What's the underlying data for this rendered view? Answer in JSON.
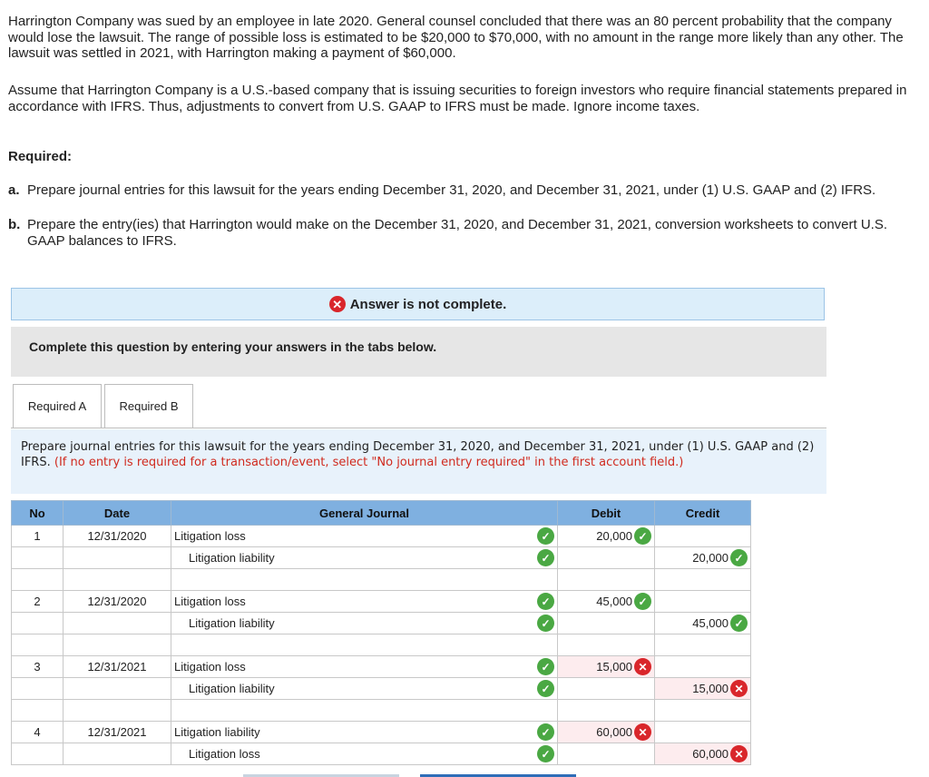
{
  "problem": {
    "p1": "Harrington Company was sued by an employee in late 2020. General counsel concluded that there was an 80 percent probability that the company would lose the lawsuit. The range of possible loss is estimated to be $20,000 to $70,000, with no amount in the range more likely than any other. The lawsuit was settled in 2021, with Harrington making a payment of $60,000.",
    "p2": "Assume that Harrington Company is a U.S.-based company that is issuing securities to foreign investors who require financial statements prepared in accordance with IFRS. Thus, adjustments to convert from U.S. GAAP to IFRS must be made. Ignore income taxes.",
    "required_heading": "Required:",
    "items": [
      {
        "label": "a.",
        "text": "Prepare journal entries for this lawsuit for the years ending December 31, 2020, and December 31, 2021, under (1) U.S. GAAP and (2) IFRS."
      },
      {
        "label": "b.",
        "text": "Prepare the entry(ies) that Harrington would make on the December 31, 2020, and December 31, 2021, conversion worksheets to convert U.S. GAAP balances to IFRS."
      }
    ]
  },
  "banner": {
    "text": "Answer is not complete.",
    "icon": "x-circle-icon"
  },
  "instruction_box": {
    "text": "Complete this question by entering your answers in the tabs below."
  },
  "tabs": [
    {
      "label": "Required A",
      "active": true
    },
    {
      "label": "Required B",
      "active": false
    }
  ],
  "tab_instruction": {
    "main": "Prepare journal entries for this lawsuit for the years ending December 31, 2020, and December 31, 2021, under (1) U.S. GAAP and (2) IFRS.",
    "note": "(If no entry is required for a transaction/event, select \"No journal entry required\" in the first account field.)"
  },
  "journal": {
    "headers": {
      "no": "No",
      "date": "Date",
      "account": "General Journal",
      "debit": "Debit",
      "credit": "Credit"
    },
    "rows": [
      {
        "no": "1",
        "date": "12/31/2020",
        "account": "Litigation loss",
        "indent": false,
        "acct_ok": true,
        "debit": "20,000",
        "debit_ok": true,
        "credit": "",
        "credit_ok": null
      },
      {
        "no": "",
        "date": "",
        "account": "Litigation liability",
        "indent": true,
        "acct_ok": true,
        "debit": "",
        "debit_ok": null,
        "credit": "20,000",
        "credit_ok": true
      },
      {
        "no": "",
        "date": "",
        "account": "",
        "indent": false,
        "acct_ok": null,
        "debit": "",
        "debit_ok": null,
        "credit": "",
        "credit_ok": null
      },
      {
        "no": "2",
        "date": "12/31/2020",
        "account": "Litigation loss",
        "indent": false,
        "acct_ok": true,
        "debit": "45,000",
        "debit_ok": true,
        "credit": "",
        "credit_ok": null
      },
      {
        "no": "",
        "date": "",
        "account": "Litigation liability",
        "indent": true,
        "acct_ok": true,
        "debit": "",
        "debit_ok": null,
        "credit": "45,000",
        "credit_ok": true
      },
      {
        "no": "",
        "date": "",
        "account": "",
        "indent": false,
        "acct_ok": null,
        "debit": "",
        "debit_ok": null,
        "credit": "",
        "credit_ok": null
      },
      {
        "no": "3",
        "date": "12/31/2021",
        "account": "Litigation loss",
        "indent": false,
        "acct_ok": true,
        "debit": "15,000",
        "debit_ok": false,
        "credit": "",
        "credit_ok": null
      },
      {
        "no": "",
        "date": "",
        "account": "Litigation liability",
        "indent": true,
        "acct_ok": true,
        "debit": "",
        "debit_ok": null,
        "credit": "15,000",
        "credit_ok": false
      },
      {
        "no": "",
        "date": "",
        "account": "",
        "indent": false,
        "acct_ok": null,
        "debit": "",
        "debit_ok": null,
        "credit": "",
        "credit_ok": null
      },
      {
        "no": "4",
        "date": "12/31/2021",
        "account": "Litigation liability",
        "indent": false,
        "acct_ok": true,
        "debit": "60,000",
        "debit_ok": false,
        "credit": "",
        "credit_ok": null
      },
      {
        "no": "",
        "date": "",
        "account": "Litigation loss",
        "indent": true,
        "acct_ok": true,
        "debit": "",
        "debit_ok": null,
        "credit": "60,000",
        "credit_ok": false
      }
    ]
  },
  "colors": {
    "correct": "#4aa843",
    "incorrect": "#d9262b",
    "header": "#7fb0e0",
    "note_red": "#d02a1e"
  }
}
